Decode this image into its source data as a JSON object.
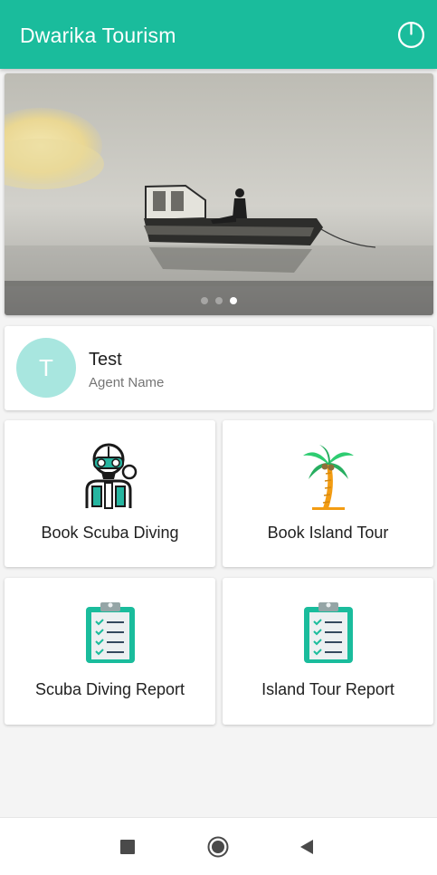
{
  "app": {
    "title": "Dwarika Tourism"
  },
  "header": {
    "power_icon": "power-icon"
  },
  "banner": {
    "slides": 3,
    "active_slide": 3,
    "colors": {
      "overlay": "#3c3c3c"
    }
  },
  "agent": {
    "initial": "T",
    "name": "Test",
    "role": "Agent Name",
    "avatar_color": "#a8e6df"
  },
  "menu": [
    {
      "label": "Book Scuba Diving",
      "icon": "scuba-diver-icon"
    },
    {
      "label": "Book Island Tour",
      "icon": "palm-tree-icon"
    },
    {
      "label": "Scuba Diving Report",
      "icon": "clipboard-checklist-icon"
    },
    {
      "label": "Island Tour Report",
      "icon": "clipboard-checklist-icon"
    }
  ],
  "system_nav": {
    "buttons": [
      "recents-square-icon",
      "home-circle-icon",
      "back-triangle-icon"
    ]
  },
  "colors": {
    "accent": "#1abc9c",
    "background": "#f4f4f4"
  }
}
